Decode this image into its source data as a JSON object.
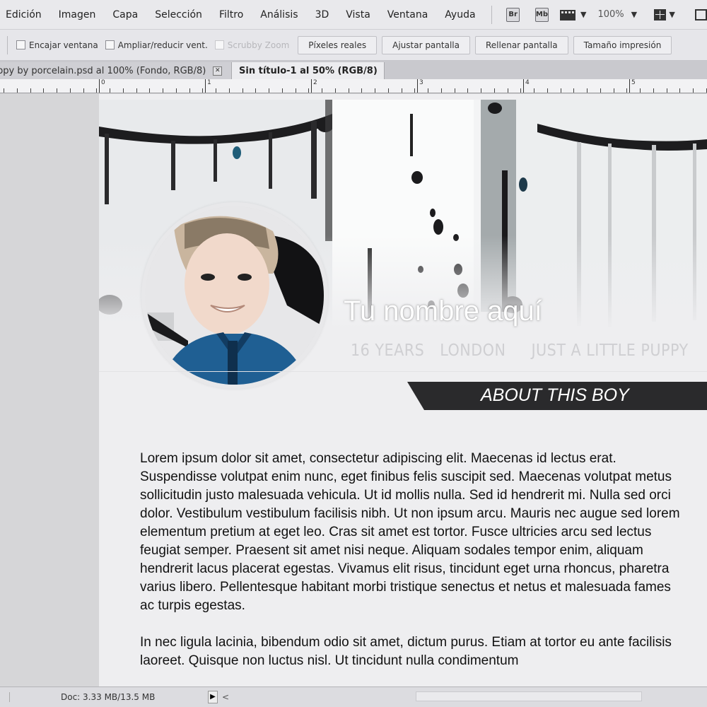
{
  "menu": [
    "Edición",
    "Imagen",
    "Capa",
    "Selección",
    "Filtro",
    "Análisis",
    "3D",
    "Vista",
    "Ventana",
    "Ayuda"
  ],
  "toolbar": {
    "br_label": "Br",
    "mb_label": "Mb",
    "zoom_value": "100%"
  },
  "options": {
    "fit_window_label": "Encajar ventana",
    "resize_windows_label": "Ampliar/reducir vent.",
    "scrubby_zoom_label": "Scrubby Zoom",
    "actual_pixels_label": "Píxeles reales",
    "fit_screen_label": "Ajustar pantalla",
    "fill_screen_label": "Rellenar pantalla",
    "print_size_label": "Tamaño impresión"
  },
  "tabs": [
    {
      "label": "ppy by porcelain.psd al 100% (Fondo, RGB/8)",
      "active": false
    },
    {
      "label": "Sin título-1 al 50% (RGB/8)",
      "active": true
    }
  ],
  "ruler": {
    "labels": [
      "0",
      "1",
      "2",
      "3",
      "4",
      "5"
    ]
  },
  "canvas": {
    "name": "Tu nombre aquí",
    "tags": [
      "16 YEARS",
      "LONDON",
      "JUST A LITTLE PUPPY"
    ],
    "about_title": "ABOUT THIS BOY",
    "paragraphs": [
      "Lorem ipsum dolor sit amet, consectetur adipiscing elit. Maecenas id lectus erat. Suspendisse volutpat enim nunc, eget finibus felis suscipit sed. Maecenas volutpat metus sollicitudin justo malesuada vehicula. Ut id mollis nulla. Sed id hendrerit mi. Nulla sed orci dolor. Vestibulum vestibulum facilisis nibh. Ut non ipsum arcu. Mauris nec augue sed lorem elementum pretium at eget leo. Cras sit amet est tortor. Fusce ultricies arcu sed lectus feugiat semper. Praesent sit amet nisi neque. Aliquam sodales tempor enim, aliquam hendrerit lacus placerat egestas. Vivamus elit risus, tincidunt eget urna rhoncus, pharetra varius libero. Pellentesque habitant morbi tristique senectus et netus et malesuada fames ac turpis egestas.",
      "In nec ligula lacinia, bibendum odio sit amet, dictum purus. Etiam at tortor eu ante facilisis laoreet. Quisque non luctus nisl. Ut tincidunt nulla condimentum"
    ]
  },
  "status": {
    "doc_size": "Doc: 3.33 MB/13.5 MB"
  },
  "colors": {
    "banner_bg": "#2a2a2c",
    "canvas_bg": "#eeeef0",
    "workspace_bg": "#d6d6d8"
  }
}
